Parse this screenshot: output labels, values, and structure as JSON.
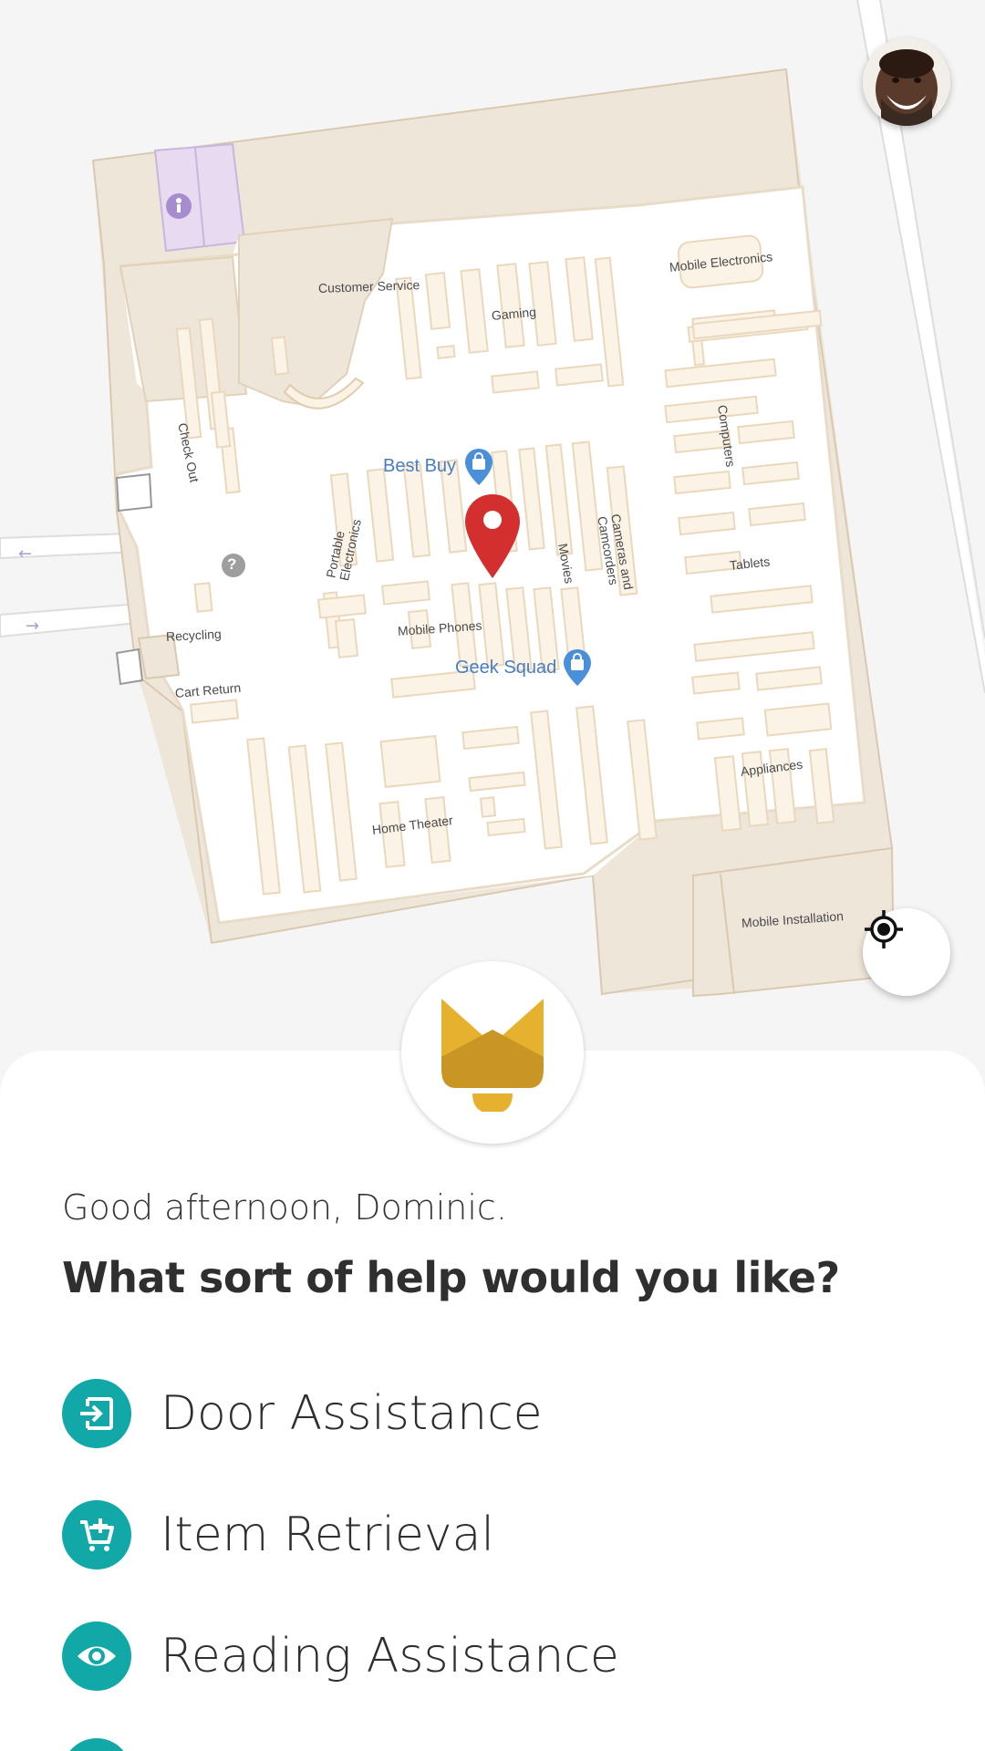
{
  "map": {
    "labels": {
      "customer_service": "Customer Service",
      "gaming": "Gaming",
      "mobile_electronics": "Mobile Electronics",
      "check_out": "Check Out",
      "computers": "Computers",
      "portable_electronics": "Portable Electronics",
      "movies": "Movies",
      "cameras_camcorders": "Cameras and Camcorders",
      "tablets": "Tablets",
      "recycling": "Recycling",
      "mobile_phones": "Mobile Phones",
      "cart_return": "Cart Return",
      "appliances": "Appliances",
      "home_theater": "Home Theater",
      "mobile_installation": "Mobile Installation"
    },
    "pois": {
      "best_buy": "Best Buy",
      "geek_squad": "Geek Squad"
    },
    "help_marker": "?"
  },
  "colors": {
    "accent": "#13a8a8",
    "pin": "#d32f2f",
    "bell": "#e6b12e",
    "poi": "#4a7dc0"
  },
  "greeting": "Good afternoon, Dominic.",
  "question": "What sort of help would you like?",
  "options": [
    {
      "label": "Door Assistance",
      "icon": "door-enter-icon"
    },
    {
      "label": "Item Retrieval",
      "icon": "cart-add-icon"
    },
    {
      "label": "Reading Assistance",
      "icon": "eye-icon"
    }
  ]
}
